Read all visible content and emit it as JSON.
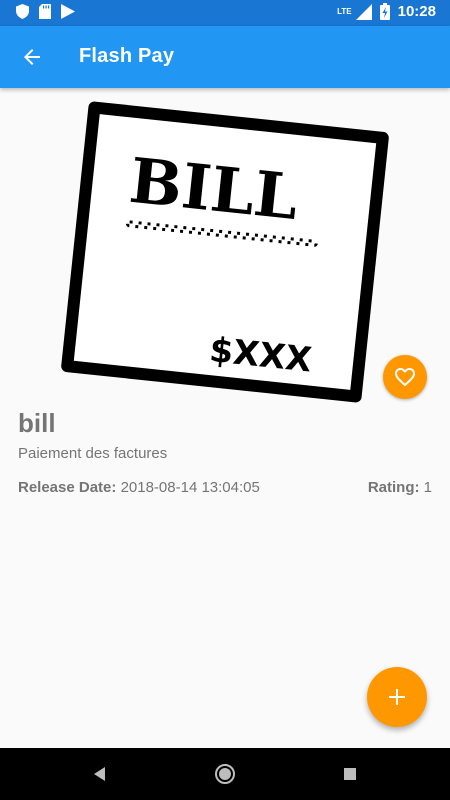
{
  "status_bar": {
    "time": "10:28",
    "network": "LTE",
    "left_icons": [
      "shield-icon",
      "sd-card-icon",
      "play-store-icon"
    ],
    "right_icons": [
      "signal-icon",
      "battery-charging-icon"
    ]
  },
  "app_bar": {
    "title": "Flash Pay",
    "back_icon": "arrow-back-icon",
    "background": "#2196f3"
  },
  "illustration": {
    "heading": "BILL",
    "amount": "$XXX"
  },
  "item": {
    "name": "bill",
    "description": "Paiement des factures",
    "release_label": "Release Date:",
    "release_value": "2018-08-14 13:04:05",
    "rating_label": "Rating:",
    "rating_value": "1"
  },
  "favorite_button": {
    "icon": "heart-outline-icon",
    "color": "#ff9800"
  },
  "fab": {
    "icon": "plus-icon",
    "color": "#ff9800"
  },
  "nav_bar": {
    "icons": [
      "back-triangle-icon",
      "home-circle-icon",
      "recents-square-icon"
    ]
  }
}
